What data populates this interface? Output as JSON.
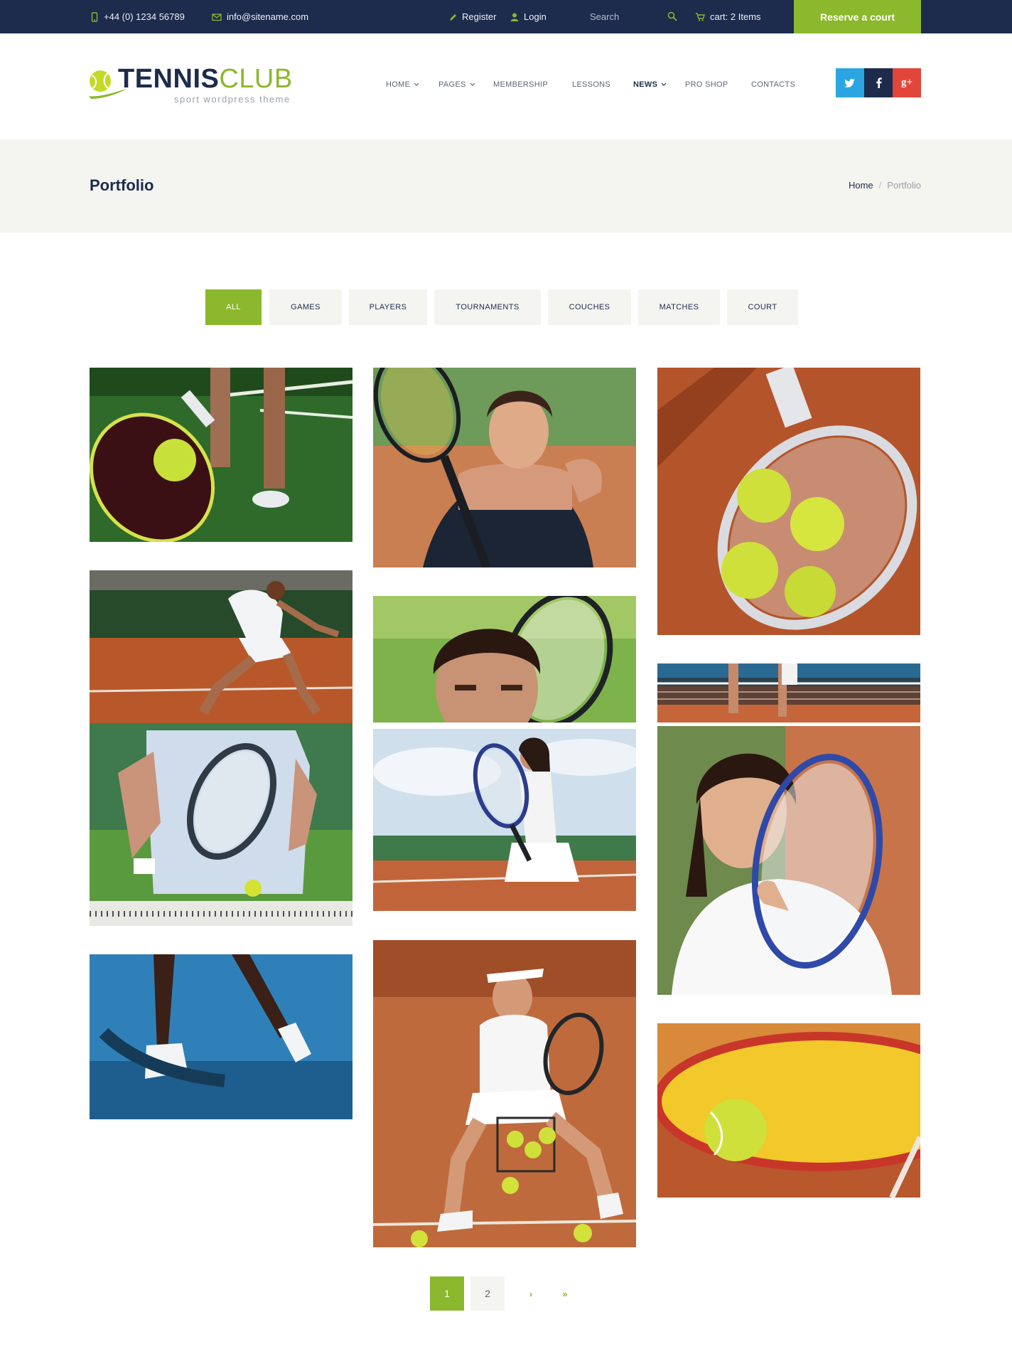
{
  "colors": {
    "navy": "#1d2b4c",
    "accent_green": "#8bb82c",
    "light_band": "#f4f4f0",
    "twitter": "#2ba5e2",
    "facebook": "#1d2b4c",
    "google_plus": "#e2463a"
  },
  "topbar": {
    "phone": "+44 (0) 1234 56789",
    "email": "info@sitename.com",
    "register_label": "Register",
    "login_label": "Login",
    "search_placeholder": "Search",
    "cart_label": "cart: 2 Items",
    "reserve_label": "Reserve a court"
  },
  "logo": {
    "word1": "TENNIS",
    "word2": "CLUB",
    "tagline": "sport wordpress theme"
  },
  "nav": {
    "items": [
      {
        "label": "HOME",
        "has_dropdown": true
      },
      {
        "label": "PAGES",
        "has_dropdown": true
      },
      {
        "label": "MEMBERSHIP",
        "has_dropdown": false
      },
      {
        "label": "LESSONS",
        "has_dropdown": false
      },
      {
        "label": "NEWS",
        "has_dropdown": true,
        "active": true
      },
      {
        "label": "PRO SHOP",
        "has_dropdown": false
      },
      {
        "label": "CONTACTS",
        "has_dropdown": false
      }
    ]
  },
  "social": [
    {
      "icon": "twitter-icon",
      "glyph": "t"
    },
    {
      "icon": "facebook-icon",
      "glyph": "f"
    },
    {
      "icon": "google-plus-icon",
      "glyph": "g+"
    }
  ],
  "page": {
    "title": "Portfolio",
    "breadcrumb_home": "Home",
    "breadcrumb_sep": "/",
    "breadcrumb_current": "Portfolio"
  },
  "filters": {
    "items": [
      "ALL",
      "GAMES",
      "PLAYERS",
      "TOURNAMENTS",
      "COUCHES",
      "MATCHES",
      "COURT"
    ],
    "selected": "ALL"
  },
  "portfolio": {
    "items": [
      {
        "name": "racket-ball-green-court-photo"
      },
      {
        "name": "smiling-woman-racket-photo"
      },
      {
        "name": "racket-three-balls-clay-photo"
      },
      {
        "name": "player-lunge-clay-photo"
      },
      {
        "name": "young-man-racket-photo"
      },
      {
        "name": "net-clay-court-photo"
      },
      {
        "name": "man-racket-ball-net-photo"
      },
      {
        "name": "woman-ready-stance-photo"
      },
      {
        "name": "smiling-woman-racket-portrait-photo"
      },
      {
        "name": "feet-blue-court-photo"
      },
      {
        "name": "woman-sitting-ball-basket-photo"
      },
      {
        "name": "yellow-racket-ball-photo"
      }
    ]
  },
  "pagination": {
    "pages": [
      "1",
      "2"
    ],
    "current": "1",
    "next_glyph": "›",
    "last_glyph": "»"
  }
}
